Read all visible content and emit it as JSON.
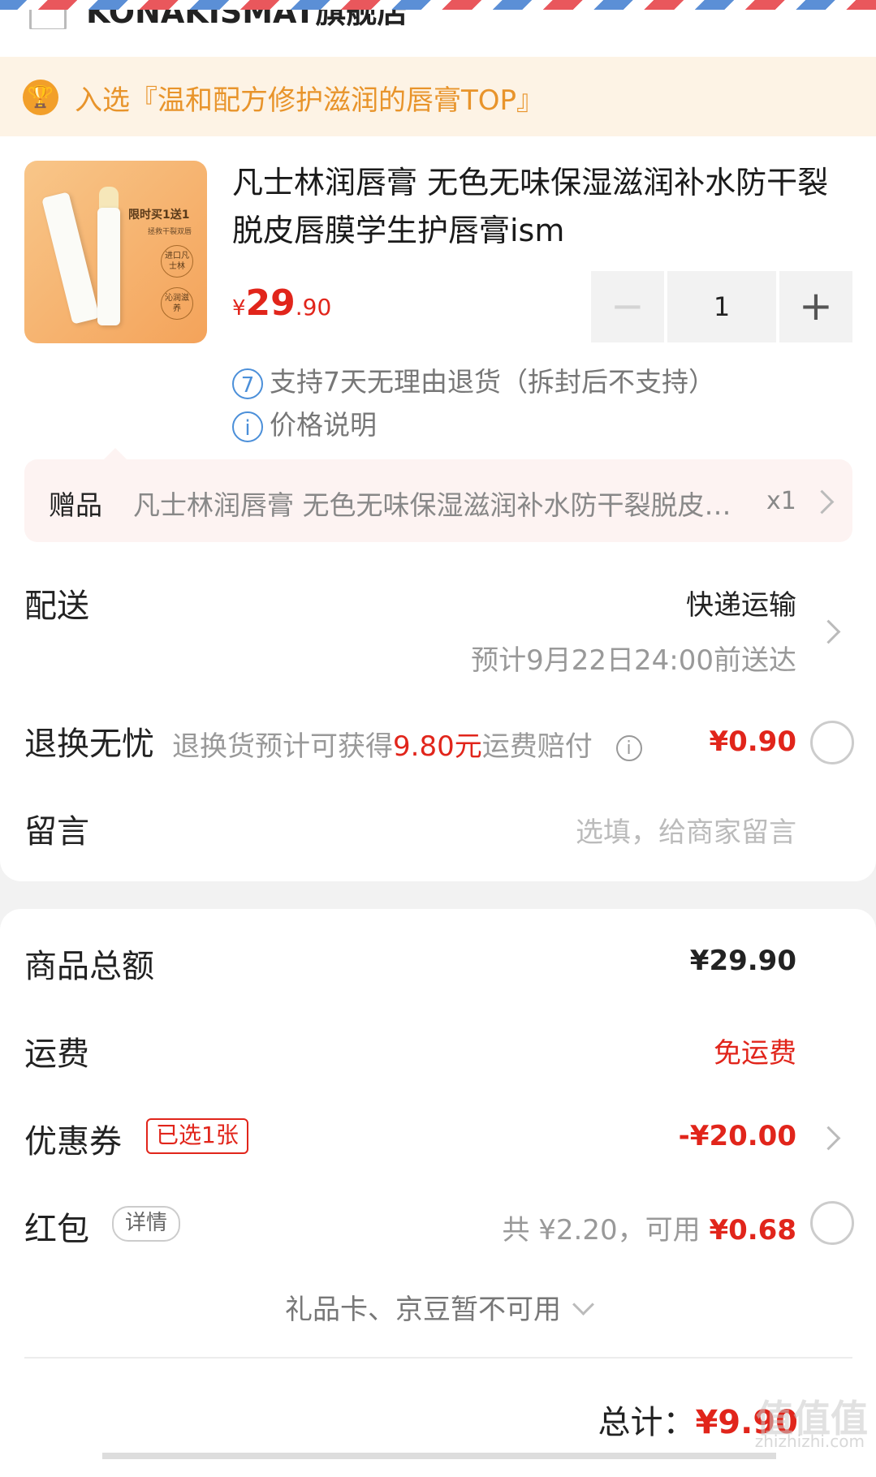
{
  "shop": {
    "name": "KONAKISMAT旗舰店"
  },
  "banner": {
    "icon": "trophy-icon",
    "text": "入选『温和配方修护滋润的唇膏TOP』"
  },
  "product": {
    "title": "凡士林润唇膏 无色无味保湿滋润补水防干裂脱皮唇膜学生护唇膏ism",
    "price_symbol": "¥",
    "price_int": "29",
    "price_dec": ".90",
    "quantity": "1",
    "thumb": {
      "promo": "限时买1送1",
      "sub": "拯救干裂双唇",
      "badge1": "进口凡士林",
      "badge2": "沁润滋养"
    },
    "services": [
      {
        "icon": "7",
        "text": "支持7天无理由退货（拆封后不支持）"
      },
      {
        "icon": "i",
        "text": "价格说明"
      }
    ]
  },
  "gift": {
    "label": "赠品",
    "name": "凡士林润唇膏 无色无味保湿滋润补水防干裂脱皮唇膜学生护唇膏ism",
    "qty": "x1"
  },
  "delivery": {
    "label": "配送",
    "method": "快递运输",
    "eta": "预计9月22日24:00前送达"
  },
  "return_ins": {
    "label": "退换无忧",
    "desc_prefix": "退换货预计可获得",
    "desc_amount": "9.80元",
    "desc_suffix": "运费赔付",
    "price": "¥0.90"
  },
  "message": {
    "label": "留言",
    "placeholder": "选填，给商家留言"
  },
  "summary": {
    "goods_label": "商品总额",
    "goods_value": "¥29.90",
    "shipping_label": "运费",
    "shipping_value": "免运费",
    "coupon_label": "优惠券",
    "coupon_tag": "已选1张",
    "coupon_value": "-¥20.00",
    "redpacket_label": "红包",
    "redpacket_tag": "详情",
    "redpacket_total": "共 ¥2.20，可用",
    "redpacket_avail": "¥0.68",
    "giftcard_text": "礼品卡、京豆暂不可用"
  },
  "total": {
    "label": "总计：",
    "amount": "¥9.90"
  },
  "watermark": {
    "text": "值值值",
    "sub": "zhizhizhi.com"
  },
  "colors": {
    "accent_red": "#e1251b",
    "banner_bg": "#fdf3e5",
    "banner_text": "#e8942b",
    "service_blue": "#4b8fd9"
  }
}
